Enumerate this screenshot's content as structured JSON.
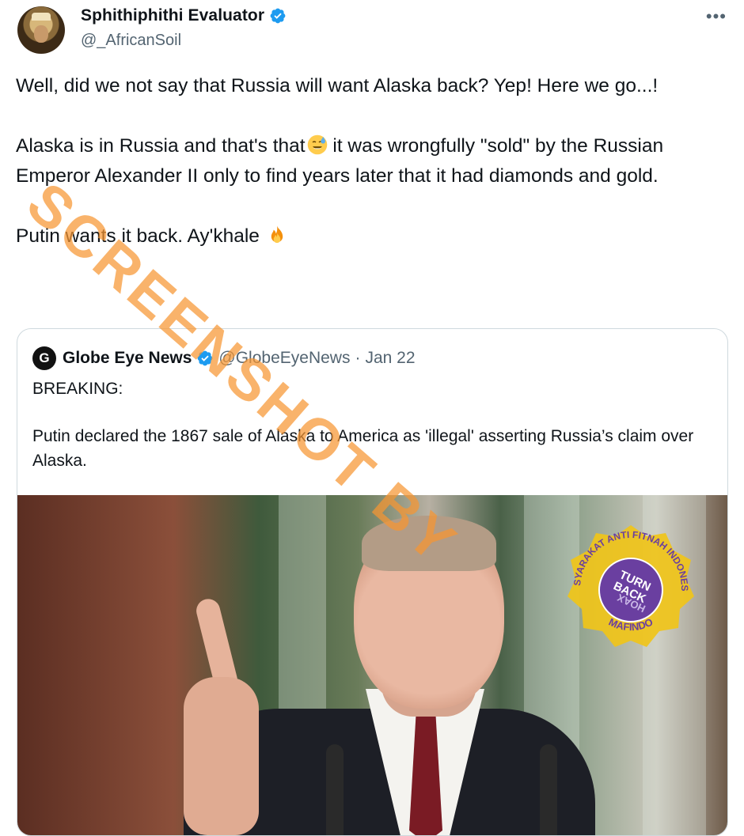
{
  "author": {
    "display_name": "Sphithiphithi Evaluator",
    "handle": "@_AfricanSoil",
    "verified": true,
    "avatar_icon": "avatar-icon"
  },
  "more_label": "•••",
  "tweet": {
    "line1": "Well, did we not say that Russia will want Alaska back? Yep! Here we go...!",
    "line2_a": "Alaska is in Russia and that's that",
    "line2_emoji": "sweat-smile-emoji",
    "line2_b": " it was wrongfully \"sold\" by the Russian Emperor Alexander II only to find years later that it had diamonds and gold.",
    "line3": "Putin wants it back. Ay'khale ",
    "line3_emoji": "fire-emoji"
  },
  "quote": {
    "logo_letter": "G",
    "name": "Globe Eye News",
    "verified": true,
    "handle": "@GlobeEyeNews",
    "separator": " · ",
    "date": "Jan 22",
    "label": "BREAKING:",
    "text": "Putin declared the 1867 sale of Alaska to America as 'illegal' asserting Russia’s claim over Alaska."
  },
  "watermark": {
    "text": "SCREENSHOT BY"
  },
  "seal": {
    "top_text": "MASYARAKAT ANTI FITNAH INDONESIA",
    "center_text_1": "TURN",
    "center_text_2": "BACK",
    "center_text_3": "HOAX",
    "bottom_text": "MAFINDO",
    "color_outer": "#f0c419",
    "color_inner": "#6a3fa0"
  },
  "colors": {
    "verified_blue": "#1d9bf0",
    "muted_text": "#536471",
    "watermark_orange": "#f79632"
  }
}
